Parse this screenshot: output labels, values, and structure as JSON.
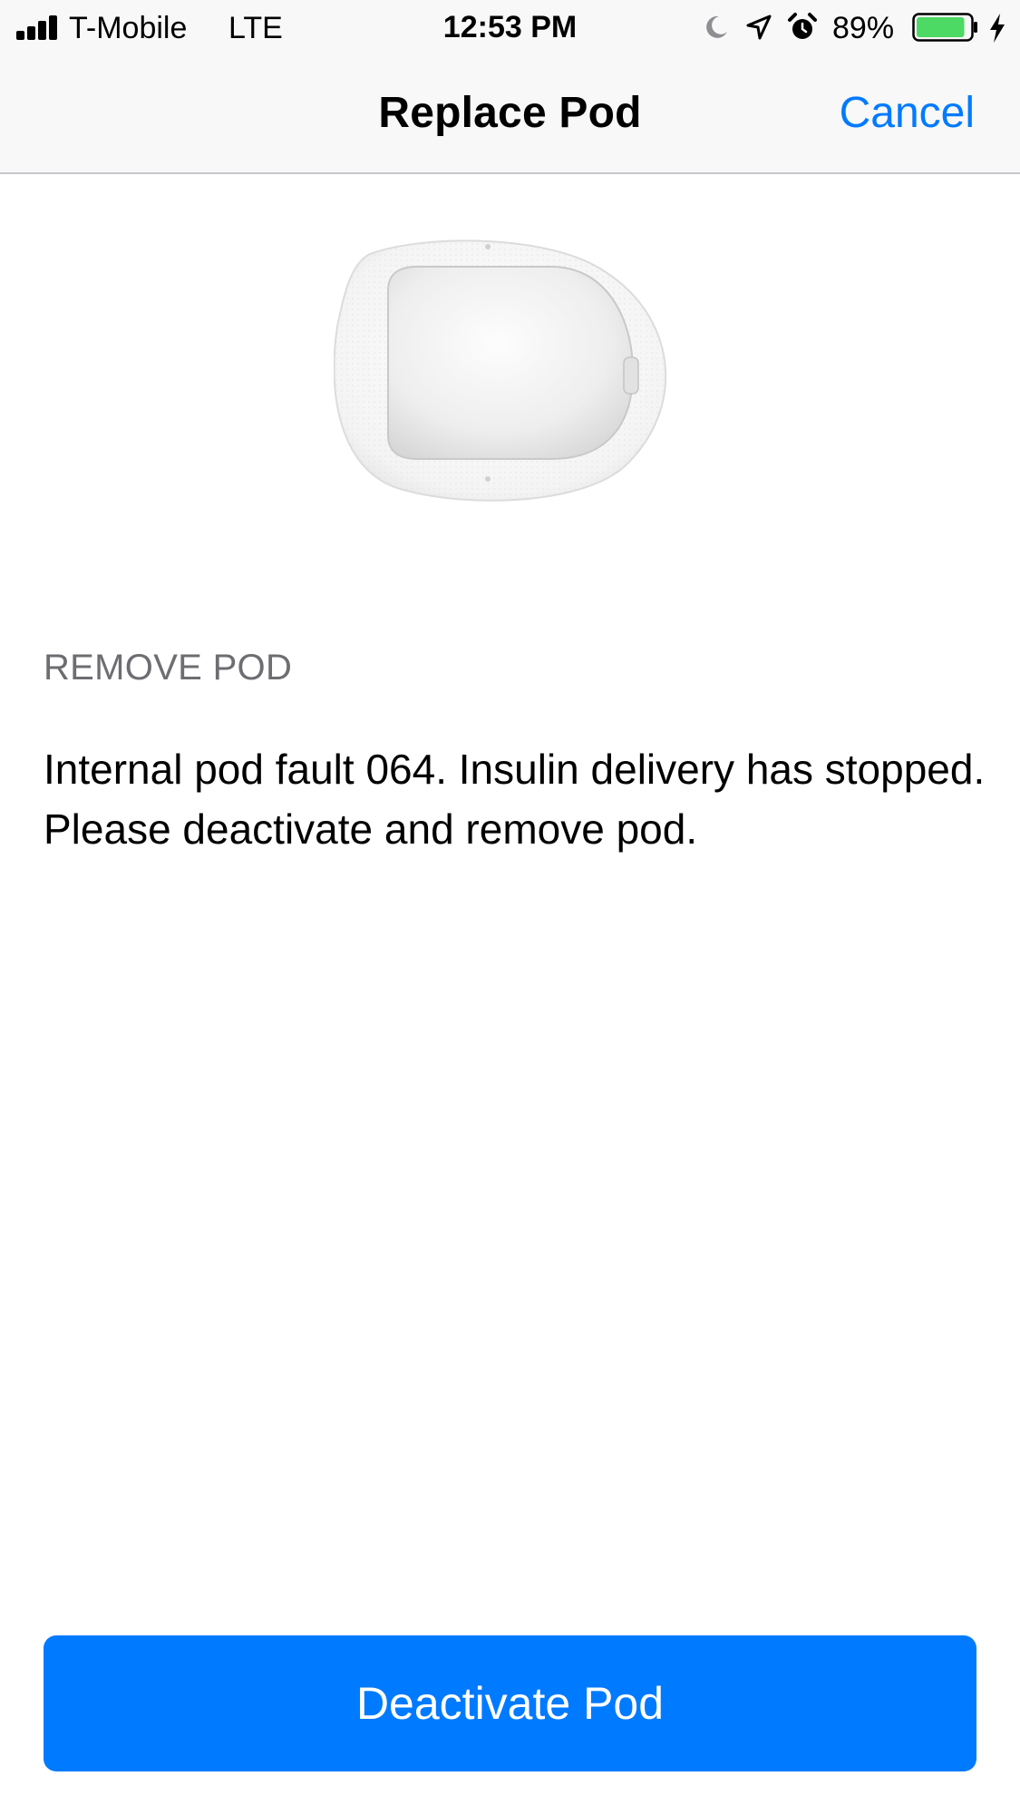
{
  "status_bar": {
    "carrier": "T-Mobile",
    "network": "LTE",
    "time": "12:53 PM",
    "battery_percent": "89%",
    "battery_level": 0.89,
    "battery_color": "#4cd964",
    "icons": [
      "signal-icon",
      "moon-icon",
      "location-arrow-icon",
      "alarm-icon",
      "battery-icon",
      "charging-bolt-icon"
    ]
  },
  "nav": {
    "title": "Replace Pod",
    "cancel_label": "Cancel",
    "accent_color": "#007aff"
  },
  "content": {
    "section_label": "REMOVE POD",
    "message": "Internal pod fault 064. Insulin delivery has stopped. Please deactivate and remove pod."
  },
  "actions": {
    "primary_label": "Deactivate Pod",
    "primary_color": "#007aff"
  }
}
